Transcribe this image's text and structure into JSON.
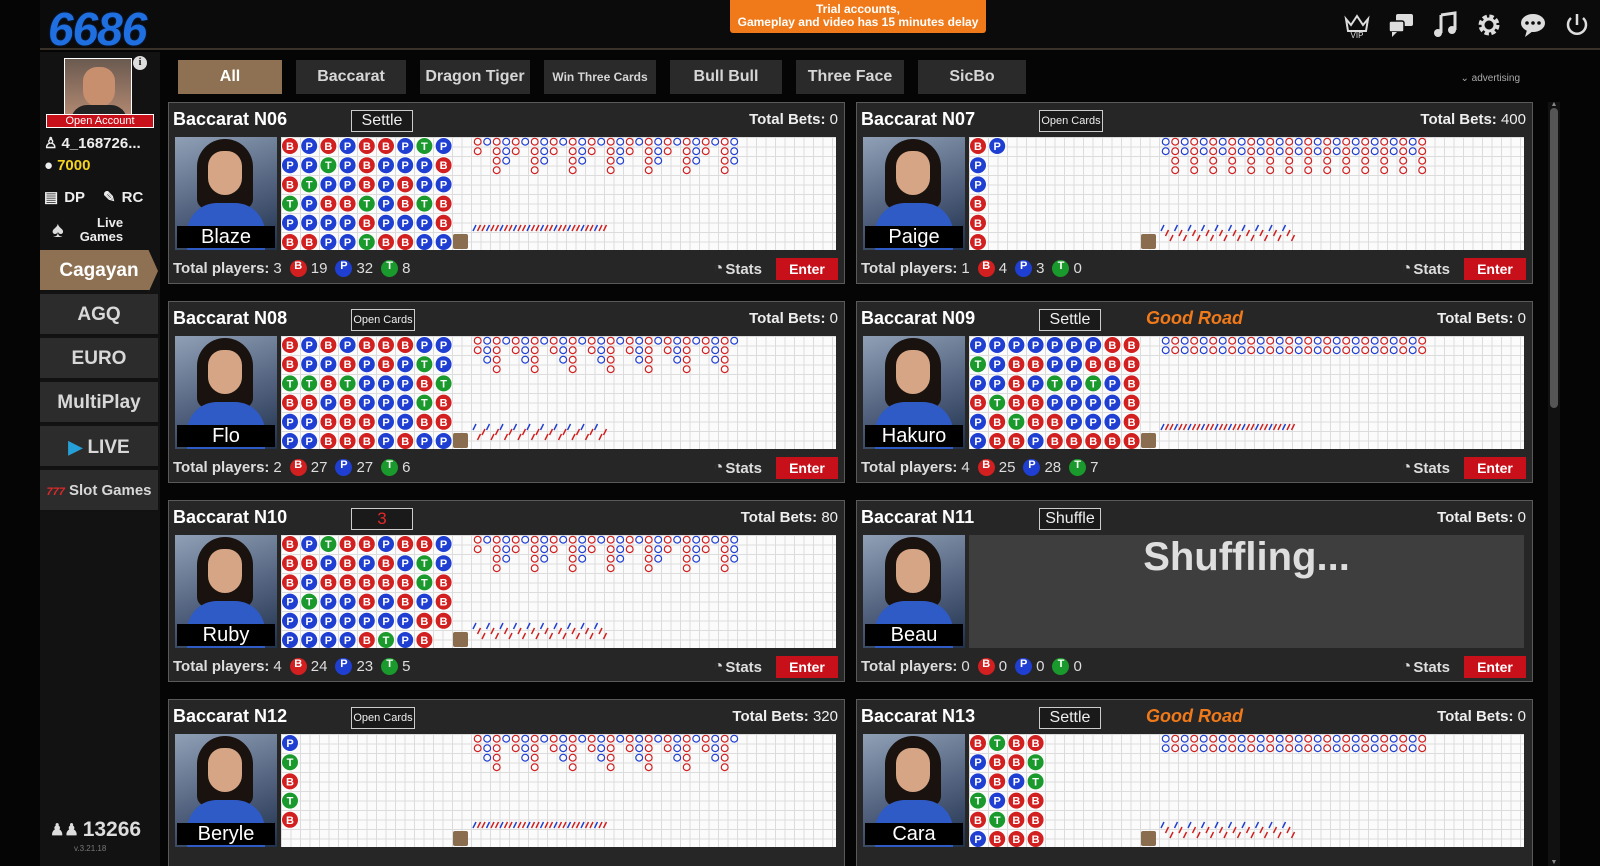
{
  "header": {
    "logo": "6686",
    "trial_line1": "Trial accounts,",
    "trial_line2": "Gameplay and video has 15 minutes delay",
    "icons": [
      "vip-icon",
      "chat-icon",
      "music-icon",
      "settings-icon",
      "message-icon",
      "power-icon"
    ],
    "vip_label": "VIP"
  },
  "sidebar": {
    "open_account": "Open Account",
    "username": "4_168726...",
    "balance": "7000",
    "dp": "DP",
    "rc": "RC",
    "live_games": "Live",
    "live_games2": "Games",
    "menu": [
      "Cagayan",
      "AGQ",
      "EURO",
      "MultiPlay",
      "LIVE",
      "Slot Games"
    ],
    "online_count": "13266",
    "version": "v.3.21.18"
  },
  "tabs": [
    "All",
    "Baccarat",
    "Dragon Tiger",
    "Win Three Cards",
    "Bull Bull",
    "Three Face",
    "SicBo"
  ],
  "advertising": "advertising",
  "labels": {
    "total_bets": "Total Bets:",
    "total_players": "Total players:",
    "stats": "Stats",
    "enter": "Enter",
    "good_road": "Good Road",
    "shuffling": "Shuffling..."
  },
  "tables": [
    {
      "name": "Baccarat N06",
      "status": "Settle",
      "good_road": false,
      "bets": "0",
      "dealer": "Blaze",
      "players": "3",
      "b": "19",
      "p": "32",
      "t": "8"
    },
    {
      "name": "Baccarat N07",
      "status": "Open Cards",
      "good_road": false,
      "bets": "400",
      "dealer": "Paige",
      "players": "1",
      "b": "4",
      "p": "3",
      "t": "0"
    },
    {
      "name": "Baccarat N08",
      "status": "Open Cards",
      "good_road": false,
      "bets": "0",
      "dealer": "Flo",
      "players": "2",
      "b": "27",
      "p": "27",
      "t": "6"
    },
    {
      "name": "Baccarat N09",
      "status": "Settle",
      "good_road": true,
      "bets": "0",
      "dealer": "Hakuro",
      "players": "4",
      "b": "25",
      "p": "28",
      "t": "7"
    },
    {
      "name": "Baccarat N10",
      "status": "3",
      "good_road": false,
      "bets": "80",
      "dealer": "Ruby",
      "players": "4",
      "b": "24",
      "p": "23",
      "t": "5"
    },
    {
      "name": "Baccarat N11",
      "status": "Shuffle",
      "good_road": false,
      "bets": "0",
      "dealer": "Beau",
      "players": "0",
      "b": "0",
      "p": "0",
      "t": "0",
      "shuffling": true
    },
    {
      "name": "Baccarat N12",
      "status": "Open Cards",
      "good_road": false,
      "bets": "320",
      "dealer": "Beryle",
      "players": "",
      "b": "",
      "p": "",
      "t": ""
    },
    {
      "name": "Baccarat N13",
      "status": "Settle",
      "good_road": true,
      "bets": "0",
      "dealer": "Cara",
      "players": "",
      "b": "",
      "p": "",
      "t": ""
    }
  ],
  "bead_roads": [
    "BPBPBBPTP PPTPBPPPB BTPPBPBPP TPBBTPBTB PPPPBPPPB BBPPTBBPP",
    "BP P P B B B",
    "BPBPBBBPP BPPBPBPTP TTBTPPPBT BBPBPPPTB PPBBBPPBB PPBBBPBPP",
    "PPPPPPPBB TPBBPPBBB PPBPTPTPB BTBBPPPPB PBTBBPPPB PBBPBBBBB",
    "BPTBBPBBP BBPBPBPTP BPBBBBBTB PTPPBPBPB PPPPPPPBB PPPPBTPB",
    "",
    "P T B T B",
    "BTBB PBBT PBPT TPBB BTBB PBBB"
  ]
}
